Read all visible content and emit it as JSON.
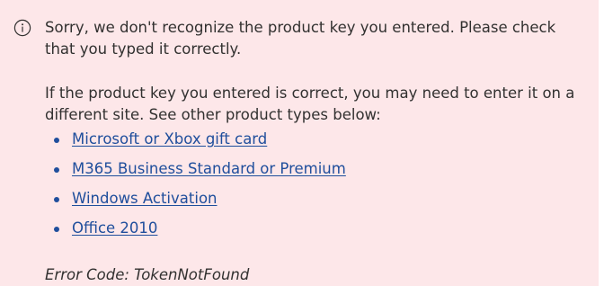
{
  "banner": {
    "icon": "info-icon",
    "background": "#fde7e9",
    "message_primary": "Sorry, we don't recognize the product key you entered. Please check that you typed it correctly.",
    "message_secondary": "If the product key you entered is correct, you may need to enter it on a different site. See other product types below:",
    "links": [
      {
        "label": "Microsoft or Xbox gift card"
      },
      {
        "label": "M365 Business Standard or Premium"
      },
      {
        "label": "Windows Activation"
      },
      {
        "label": "Office 2010"
      }
    ],
    "error_code": "Error Code: TokenNotFound"
  },
  "colors": {
    "link": "#1f4e9c",
    "text": "#323130"
  }
}
